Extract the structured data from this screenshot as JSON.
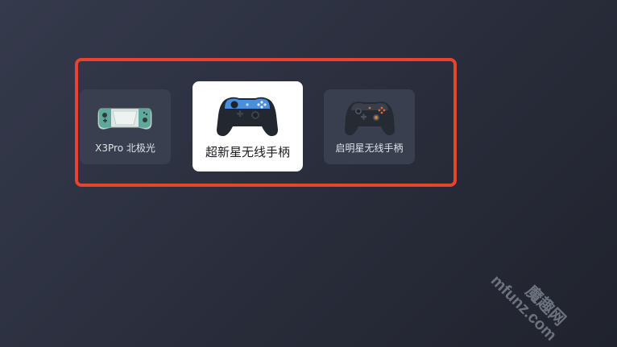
{
  "devices": [
    {
      "label": "X3Pro 北极光",
      "icon": "handheld-console-icon",
      "selected": false
    },
    {
      "label": "超新星无线手柄",
      "icon": "gamepad-blue-icon",
      "selected": true
    },
    {
      "label": "启明星无线手柄",
      "icon": "gamepad-dark-icon",
      "selected": false
    }
  ],
  "highlight_color": "#e8432f",
  "watermark": {
    "site": "魔趣网",
    "url": "mfunz.com"
  }
}
